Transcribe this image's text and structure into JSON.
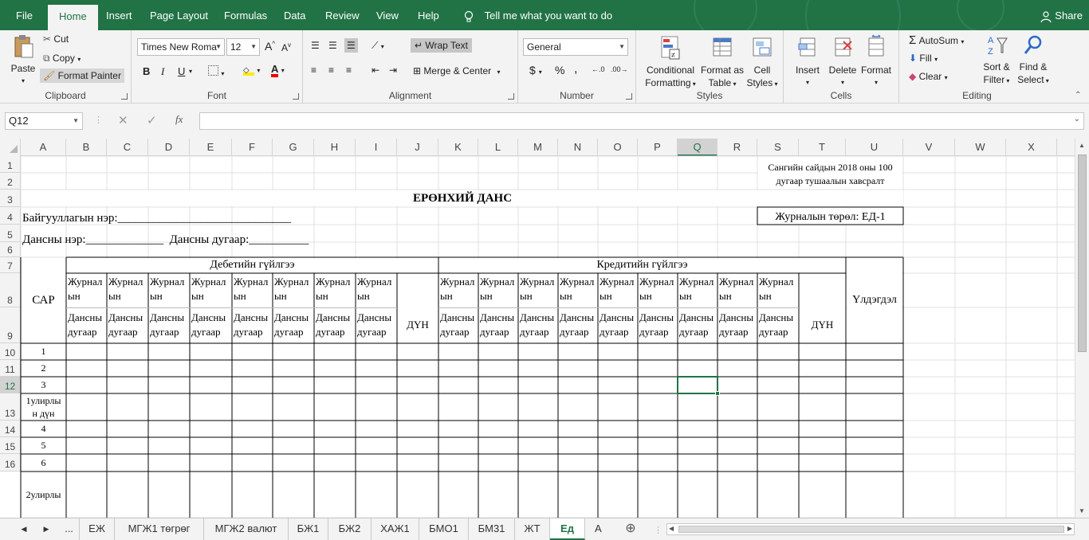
{
  "menu": {
    "tabs": [
      "File",
      "Home",
      "Insert",
      "Page Layout",
      "Formulas",
      "Data",
      "Review",
      "View",
      "Help"
    ],
    "active": "Home",
    "tell_me": "Tell me what you want to do",
    "share": "Share"
  },
  "ribbon": {
    "clipboard": {
      "paste": "Paste",
      "cut": "Cut",
      "copy": "Copy",
      "format_painter": "Format Painter",
      "label": "Clipboard"
    },
    "font": {
      "name": "Times New Roma",
      "size": "12",
      "bold": "B",
      "italic": "I",
      "underline": "U",
      "label": "Font"
    },
    "alignment": {
      "wrap": "Wrap Text",
      "merge": "Merge & Center",
      "label": "Alignment"
    },
    "number": {
      "format": "General",
      "currency": "$",
      "percent": "%",
      "comma": ",",
      "label": "Number"
    },
    "styles": {
      "conditional": [
        "Conditional",
        "Formatting"
      ],
      "format_table": [
        "Format as",
        "Table"
      ],
      "cell_styles": [
        "Cell",
        "Styles"
      ],
      "label": "Styles"
    },
    "cells": {
      "insert": "Insert",
      "delete": "Delete",
      "format": "Format",
      "label": "Cells"
    },
    "editing": {
      "autosum": "AutoSum",
      "fill": "Fill",
      "clear": "Clear",
      "sort": [
        "Sort &",
        "Filter"
      ],
      "find": [
        "Find &",
        "Select"
      ],
      "label": "Editing"
    }
  },
  "formula_bar": {
    "name_box": "Q12",
    "fx": "fx",
    "content": ""
  },
  "columns": [
    "A",
    "B",
    "C",
    "D",
    "E",
    "F",
    "G",
    "H",
    "I",
    "J",
    "K",
    "L",
    "M",
    "N",
    "O",
    "P",
    "Q",
    "R",
    "S",
    "T",
    "U",
    "V",
    "W",
    "X"
  ],
  "rows": [
    "1",
    "2",
    "3",
    "4",
    "5",
    "6",
    "7",
    "8",
    "9",
    "10",
    "11",
    "12",
    "13",
    "14",
    "15",
    "16"
  ],
  "selected_cell": "Q12",
  "sheet": {
    "note": [
      "Сангийн сайдын 2018 оны 100",
      "дугаар тушаалын хавсралт"
    ],
    "title": "ЕРӨНХИЙ ДАНС",
    "org": "Байгууллагын нэр:_____________________________",
    "journal_type": "Журналын төрөл: ЕД-1",
    "account": "Дансны нэр:_____________  Дансны дугаар:__________",
    "debit_header": "Дебетийн гүйлгээ",
    "credit_header": "Кредитийн гүйлгээ",
    "month": "САР",
    "sum": "ДҮН",
    "balance": "Үлдэгдэл",
    "jtype": "Журнал\nын\nтөрөл\n........",
    "accno": "Дансны\nдугаар\n.........",
    "row_labels": [
      "1",
      "2",
      "3",
      "1улирлы\nн дүн",
      "4",
      "5",
      "6",
      "2улирлы"
    ]
  },
  "sheet_tabs": [
    "...",
    "ЕЖ",
    "МГЖ1 төгрөг",
    "МГЖ2 валют",
    "БЖ1",
    "БЖ2",
    "ХАЖ1",
    "БМО1",
    "БМ31",
    "ЖТ",
    "Ед",
    "А"
  ],
  "active_sheet": "Ед"
}
